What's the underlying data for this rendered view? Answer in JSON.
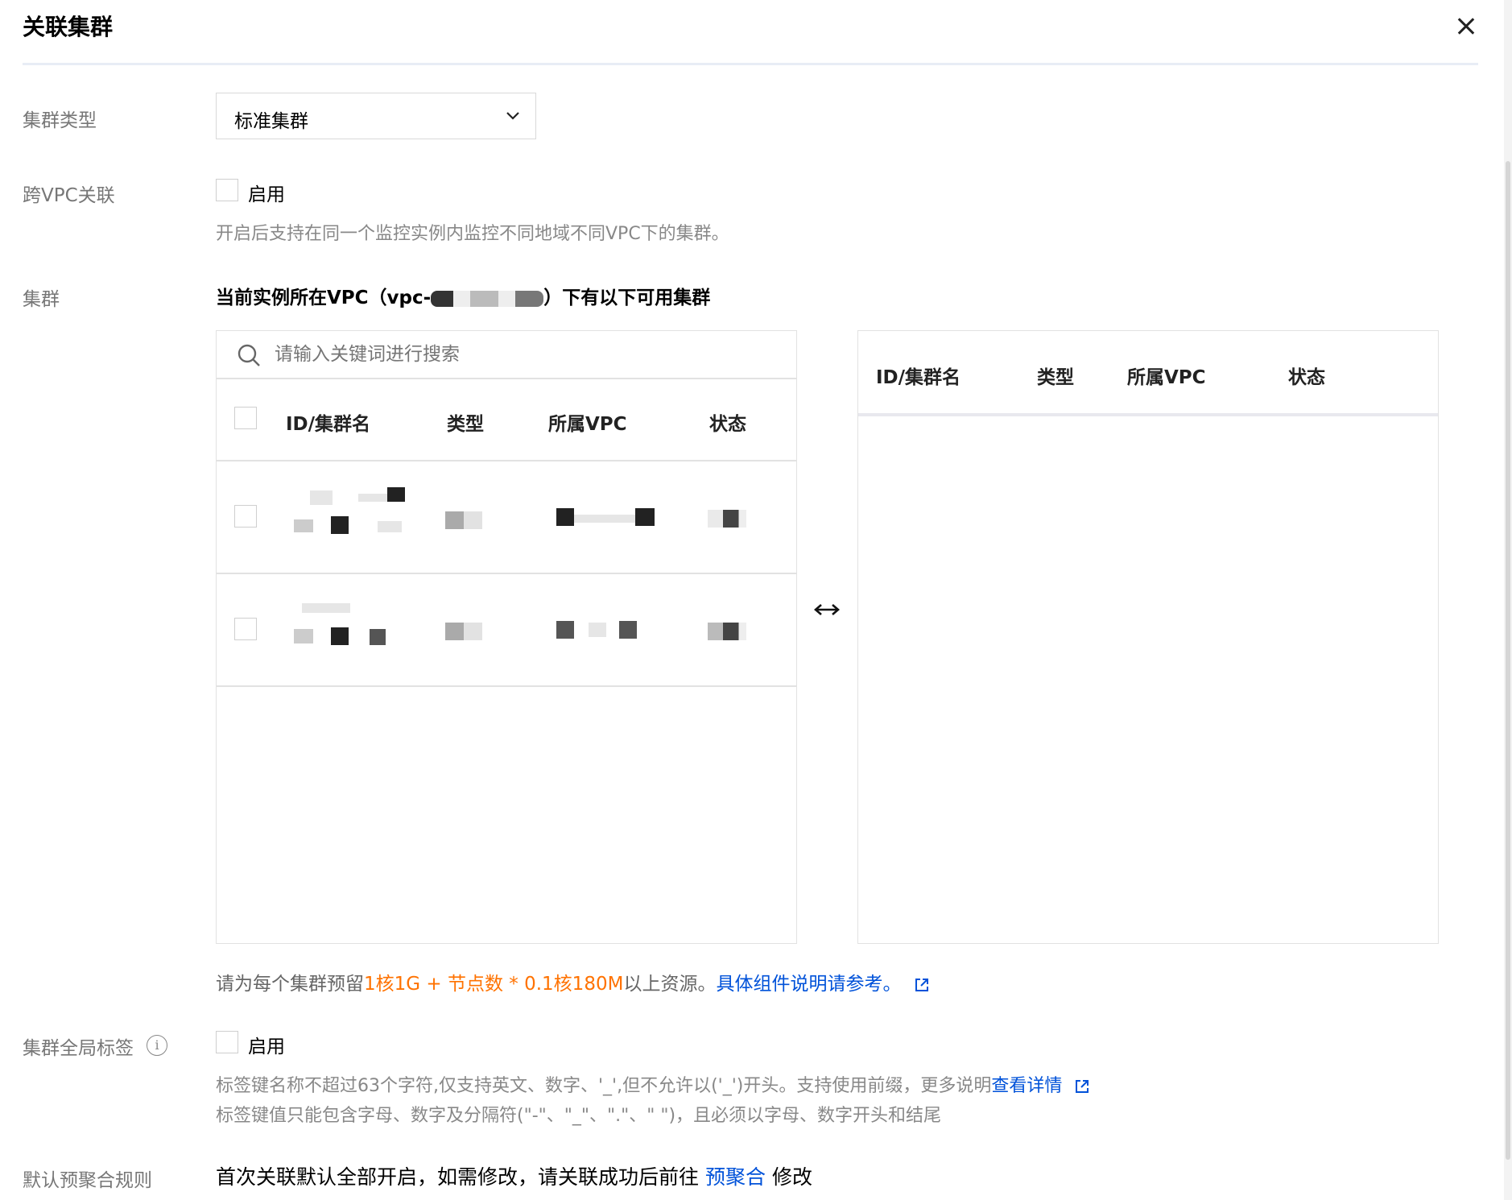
{
  "dialog": {
    "title": "关联集群"
  },
  "form": {
    "cluster_type": {
      "label": "集群类型",
      "selected": "标准集群"
    },
    "cross_vpc": {
      "label": "跨VPC关联",
      "checkbox_label": "启用",
      "hint": "开启后支持在同一个监控实例内监控不同地域不同VPC下的集群。"
    },
    "cluster": {
      "label": "集群",
      "title_prefix": "当前实例所在VPC（vpc-",
      "title_suffix": "）下有以下可用集群",
      "search_placeholder": "请输入关键词进行搜索",
      "left_columns": [
        "ID/集群名",
        "类型",
        "所属VPC",
        "状态"
      ],
      "right_columns": [
        "ID/集群名",
        "类型",
        "所属VPC",
        "状态"
      ],
      "note_prefix": "请为每个集群预留",
      "note_highlight": "1核1G + 节点数 * 0.1核180M",
      "note_middle": "以上资源。",
      "note_link": "具体组件说明请参考。"
    },
    "global_tags": {
      "label": "集群全局标签",
      "checkbox_label": "启用",
      "hint_line1": "标签键名称不超过63个字符,仅支持英文、数字、'_',但不允许以('_')开头。支持使用前缀，更多说明",
      "hint_link": "查看详情",
      "hint_line2": "标签键值只能包含字母、数字及分隔符(\"-\"、\"_\"、\".\"、\" \")，且必须以字母、数字开头和结尾"
    },
    "pre_aggregation": {
      "label": "默认预聚合规则",
      "text_prefix": "首次关联默认全部开启，如需修改，请关联成功后前往",
      "link": "预聚合",
      "text_suffix": "修改"
    }
  }
}
